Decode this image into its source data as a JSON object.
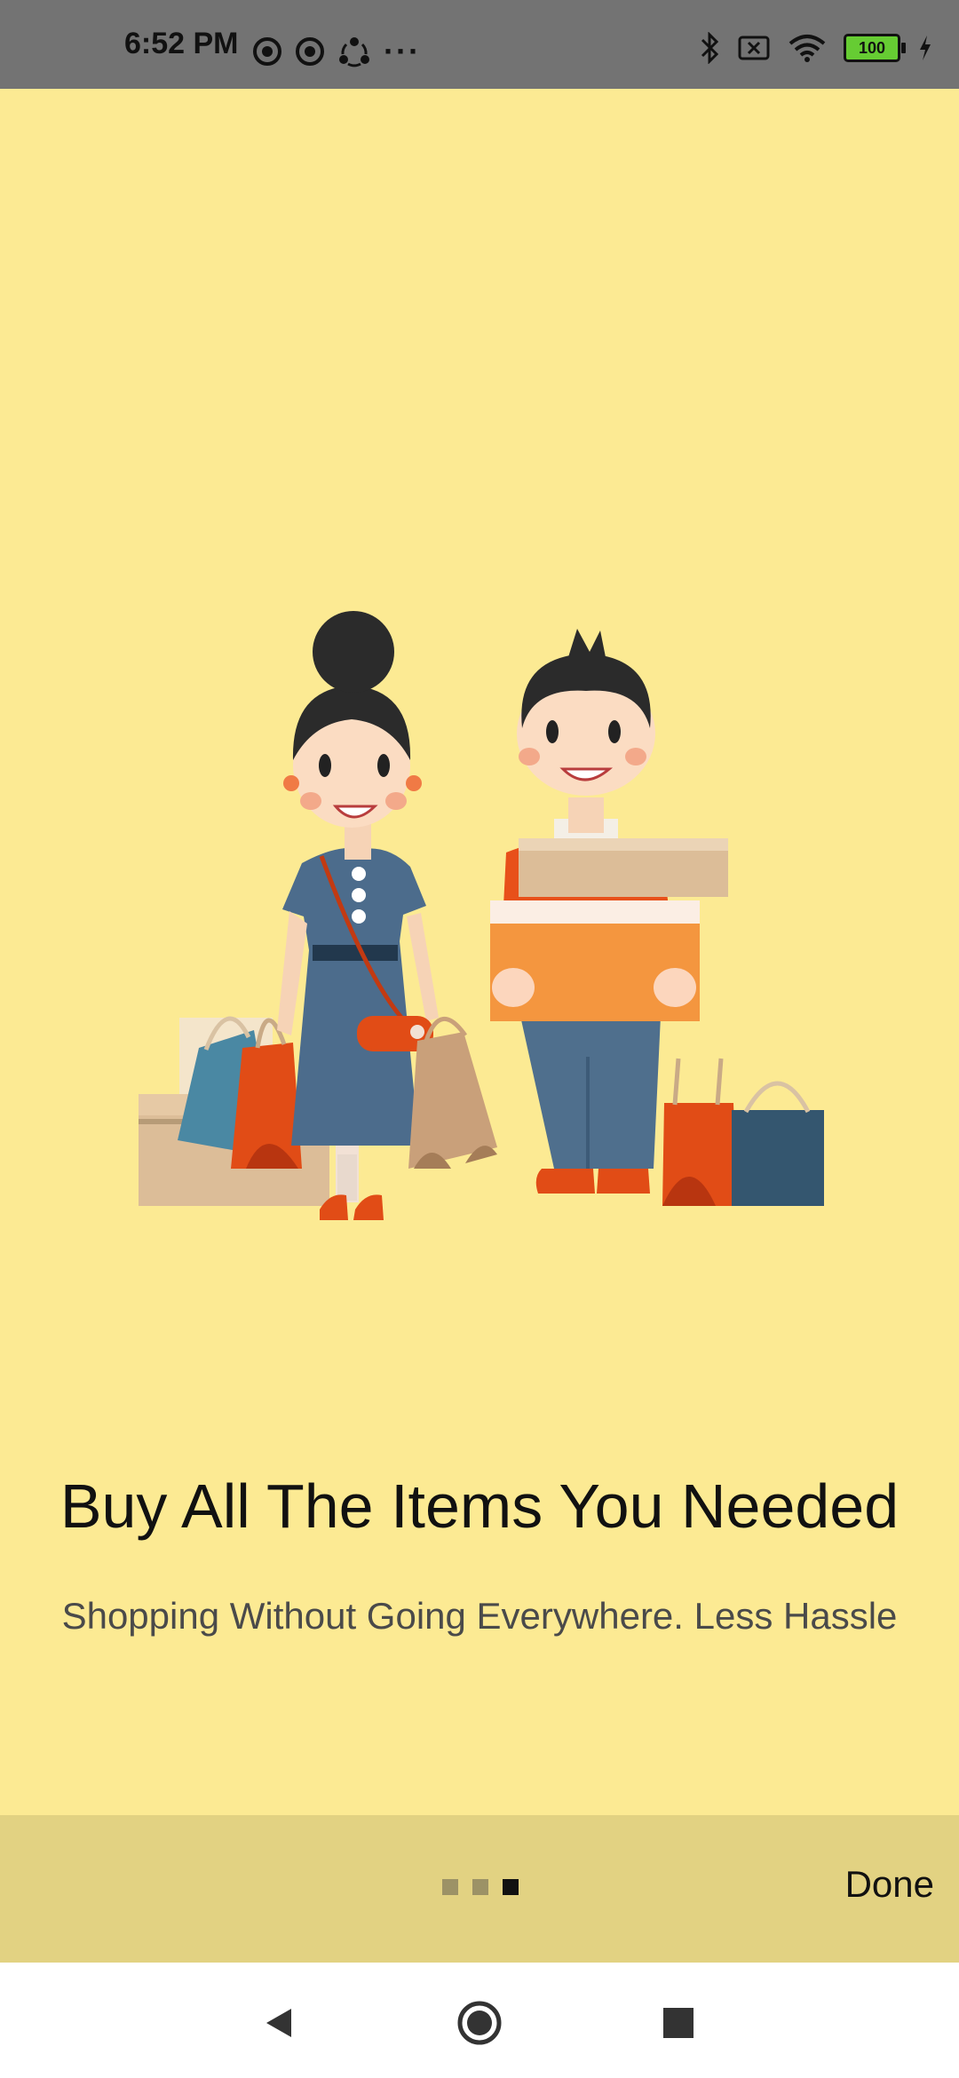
{
  "status_bar": {
    "time": "6:52 PM",
    "left_icons": [
      "notification-icon",
      "notification-icon",
      "sync-icon",
      "more-dots-icon"
    ],
    "more_text": "···",
    "right_icons": [
      "bluetooth-icon",
      "no-sim-icon",
      "wifi-icon",
      "battery-icon",
      "charging-icon"
    ],
    "battery_level": "100"
  },
  "onboarding": {
    "illustration": "shopping-couple-illustration",
    "title": "Buy All The Items You Needed",
    "subtitle": "Shopping Without Going Everywhere. Less Hassle"
  },
  "pager": {
    "total": 3,
    "active_index": 2
  },
  "bottom_bar": {
    "done_label": "Done"
  },
  "nav_bar": {
    "buttons": [
      "back-icon",
      "home-icon",
      "recents-icon"
    ]
  },
  "colors": {
    "background": "#fcea93",
    "bottom_bar": "#e2d282",
    "status_bar": "#737373"
  }
}
